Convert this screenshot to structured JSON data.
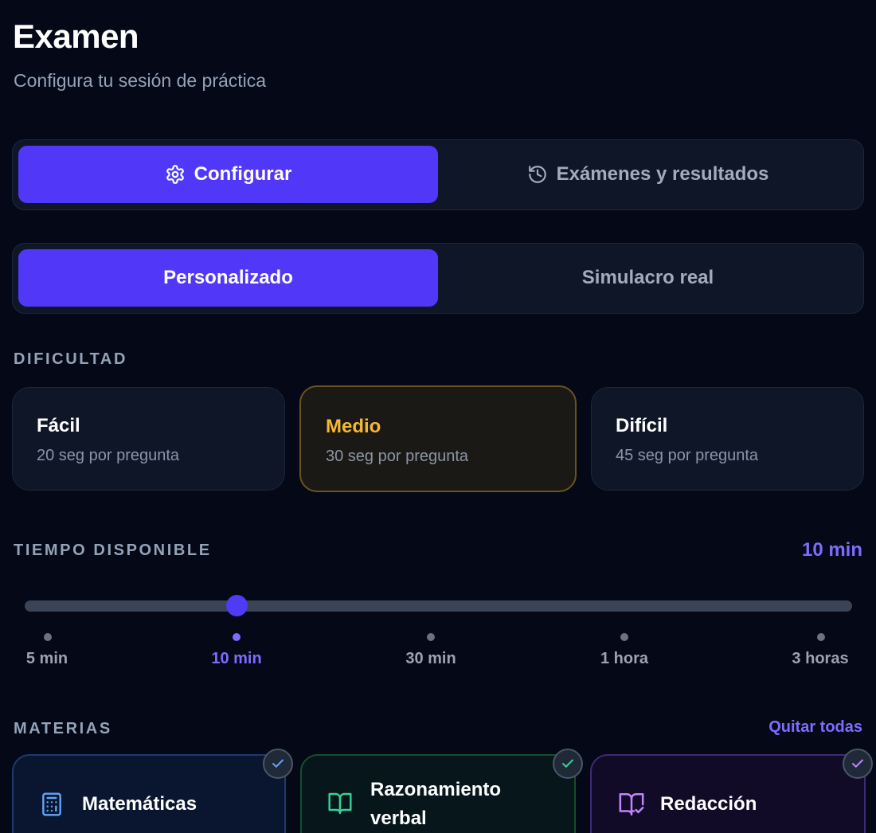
{
  "header": {
    "title": "Examen",
    "subtitle": "Configura tu sesión de práctica"
  },
  "main_tabs": [
    {
      "label": "Configurar",
      "icon": "gear-icon",
      "active": true
    },
    {
      "label": "Exámenes y resultados",
      "icon": "history-icon",
      "active": false
    }
  ],
  "mode_tabs": [
    {
      "label": "Personalizado",
      "active": true
    },
    {
      "label": "Simulacro real",
      "active": false
    }
  ],
  "difficulty": {
    "label": "DIFICULTAD",
    "options": [
      {
        "name": "Fácil",
        "desc": "20 seg por pregunta",
        "selected": false
      },
      {
        "name": "Medio",
        "desc": "30 seg por pregunta",
        "selected": true
      },
      {
        "name": "Difícil",
        "desc": "45 seg por pregunta",
        "selected": false
      }
    ]
  },
  "time": {
    "label": "TIEMPO DISPONIBLE",
    "value": "10 min",
    "selected_index": 1,
    "ticks": [
      "5 min",
      "10 min",
      "30 min",
      "1 hora",
      "3 horas"
    ]
  },
  "subjects": {
    "label": "MATERIAS",
    "clear_all": "Quitar todas",
    "items": [
      {
        "name": "Matemáticas",
        "icon": "calculator-icon",
        "color": "#60a5fa",
        "checked": true
      },
      {
        "name": "Razonamiento verbal",
        "icon": "book-open-icon",
        "color": "#34d399",
        "checked": true
      },
      {
        "name": "Redacción",
        "icon": "book-check-icon",
        "color": "#c084fc",
        "checked": true
      }
    ]
  },
  "colors": {
    "background": "#050816",
    "accent": "#5138f8",
    "accent_text": "#7c6cff",
    "medium": "#f5b82e"
  }
}
